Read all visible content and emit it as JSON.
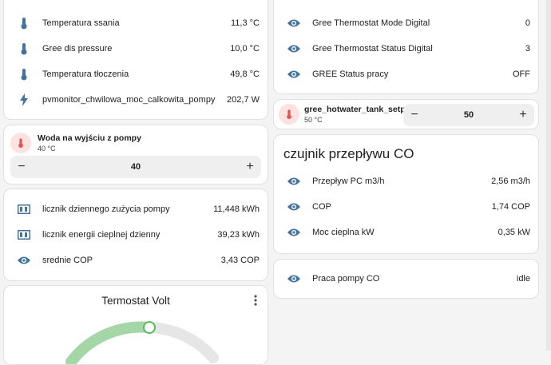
{
  "card_sensors": {
    "rows": [
      {
        "icon": "thermometer-icon",
        "label": "Temperatura ssania",
        "value": "11,3 °C"
      },
      {
        "icon": "thermometer-icon",
        "label": "Gree dis pressure",
        "value": "10,0 °C"
      },
      {
        "icon": "thermometer-icon",
        "label": "Temperatura tłoczenia",
        "value": "49,8 °C"
      },
      {
        "icon": "flash-icon",
        "label": "pvmonitor_chwilowa_moc_calkowita_pompy",
        "value": "202,7 W"
      }
    ]
  },
  "tile_water_out": {
    "name": "Woda na wyjściu z pompy",
    "state": "40 °C",
    "value": "40",
    "icon": "thermometer-icon"
  },
  "card_counters": {
    "rows": [
      {
        "icon": "counter-icon",
        "label": "licznik dziennego zużycia pompy",
        "value": "11,448 kWh"
      },
      {
        "icon": "counter-icon",
        "label": "licznik energii cieplnej dzienny",
        "value": "39,23 kWh"
      },
      {
        "icon": "eye-icon",
        "label": "srednie COP",
        "value": "3,43 COP"
      }
    ]
  },
  "thermostat": {
    "title": "Termostat Volt",
    "menu_icon": "dots-vertical-icon"
  },
  "card_gree": {
    "rows": [
      {
        "icon": "eye-icon",
        "label": "Gree Thermostat Mode Digital",
        "value": "0"
      },
      {
        "icon": "eye-icon",
        "label": "Gree Thermostat Status Digital",
        "value": "3"
      },
      {
        "icon": "eye-icon",
        "label": "GREE Status pracy",
        "value": "OFF"
      }
    ]
  },
  "tile_hotwater": {
    "name": "gree_hotwater_tank_setp...",
    "state": "50 °C",
    "value": "50",
    "icon": "thermometer-icon"
  },
  "card_flow": {
    "title": "czujnik przepływu CO",
    "rows": [
      {
        "icon": "eye-icon",
        "label": "Przepływ PC m3/h",
        "value": "2,56 m3/h"
      },
      {
        "icon": "eye-icon",
        "label": "COP",
        "value": "1,74 COP"
      },
      {
        "icon": "eye-icon",
        "label": "Moc cieplna kW",
        "value": "0,35 kW"
      }
    ]
  },
  "card_work": {
    "rows": [
      {
        "icon": "eye-icon",
        "label": "Praca pompy CO",
        "value": "idle"
      }
    ]
  },
  "stepper": {
    "minus": "−",
    "plus": "+"
  },
  "colors": {
    "icon_blue": "#44739e",
    "thermo_red": "#e05454",
    "gauge_green": "#a5d6a7",
    "gauge_track": "#e6e6e6",
    "knob": "#5cb85c"
  }
}
